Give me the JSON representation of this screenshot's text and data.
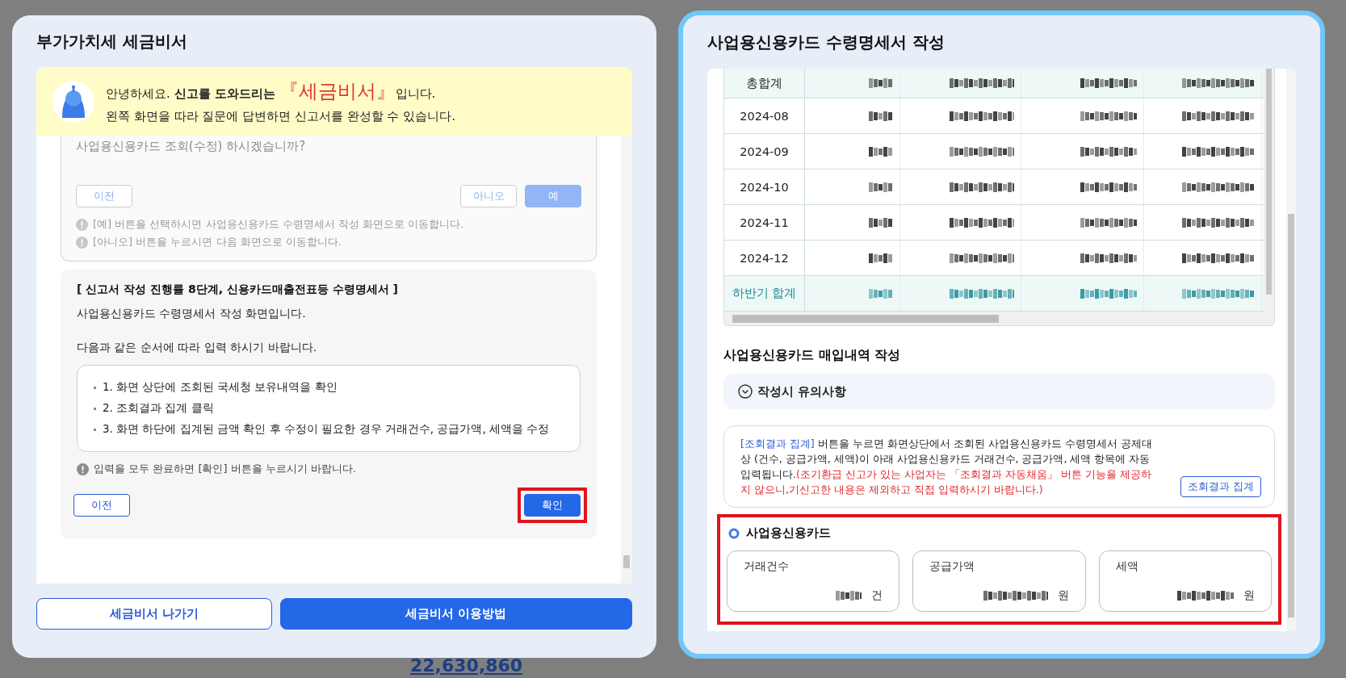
{
  "background": {
    "amount": "22,630,860"
  },
  "assistant": {
    "title": "부가가치세 세금비서",
    "banner": {
      "before": "안녕하세요. **신고를 도와드리는** ",
      "brand": "『세금비서』",
      "after": "입니다.",
      "line2": "왼쪽 화면을 따라 질문에 답변하면 신고서를 완성할 수 있습니다."
    },
    "question_card": {
      "disabled": true,
      "question": "사업용신용카드 조회(수정) 하시겠습니까?",
      "buttons": [
        {
          "label": "이전",
          "kind": "outline"
        },
        {
          "label": "아니오",
          "kind": "outline"
        },
        {
          "label": "예",
          "kind": "primary"
        }
      ],
      "notes": [
        "[예] 버튼을 선택하시면 사업용신용카드 수령명세서 작성 화면으로 이동합니다.",
        "[아니오] 버튼을 누르시면 다음 화면으로 이동합니다."
      ]
    },
    "step_card": {
      "title": "[ 신고서 작성 진행률 8단계, 신용카드매출전표등 수령명세서 ]",
      "intro": "사업용신용카드 수령명세서 작성 화면입니다.",
      "instruction": "다음과 같은 순서에 따라 입력 하시기 바랍니다.",
      "steps": [
        "1. 화면 상단에 조회된 국세청 보유내역을 확인",
        "2. 조회결과 집계 클릭",
        "3. 화면 하단에 집계된 금액 확인 후 수정이 필요한 경우 거래건수, 공급가액, 세액을 수정"
      ],
      "note": "입력을 모두 완료하면 [확인] 버튼을 누르시기 바랍니다.",
      "buttons": [
        {
          "label": "이전",
          "kind": "outline",
          "highlighted": false
        },
        {
          "label": "확인",
          "kind": "primary",
          "highlighted": true
        }
      ]
    },
    "footer_buttons": [
      {
        "label": "세금비서 나가기",
        "kind": "outline"
      },
      {
        "label": "세금비서 이용방법",
        "kind": "primary"
      }
    ]
  },
  "form": {
    "title": "사업용신용카드 수령명세서 작성",
    "table": {
      "rows": [
        {
          "period": "총합계",
          "kind": "total"
        },
        {
          "period": "2024-08",
          "kind": "month"
        },
        {
          "period": "2024-09",
          "kind": "month"
        },
        {
          "period": "2024-10",
          "kind": "month"
        },
        {
          "period": "2024-11",
          "kind": "month"
        },
        {
          "period": "2024-12",
          "kind": "month"
        },
        {
          "period": "하반기 합계",
          "kind": "subtotal"
        }
      ]
    },
    "section_title": "사업용신용카드 매입내역 작성",
    "notice": {
      "label": "작성시 유의사항",
      "expanded": false
    },
    "info": {
      "link": "[조회결과 집계]",
      "text": " 버튼을 누르면 화면상단에서 조회된 사업용신용카드 수령명세서 공제대상 (건수, 공급가액, 세액)이 아래 사업용신용카드 거래건수, 공급가액, 세액 항목에 자동입력됩니다.",
      "warning": "(조기환급 신고가 있는 사업자는 「조회결과 자동채움」 버튼 기능을 제공하지 않으니,기신고한 내용은 제외하고 직접 입력하시기 바랍니다.)",
      "button": "조회결과 집계"
    },
    "card_section": {
      "label": "사업용신용카드",
      "highlighted": true,
      "fields": [
        {
          "label": "거래건수",
          "unit": "건"
        },
        {
          "label": "공급가액",
          "unit": "원"
        },
        {
          "label": "세액",
          "unit": "원"
        }
      ]
    }
  }
}
